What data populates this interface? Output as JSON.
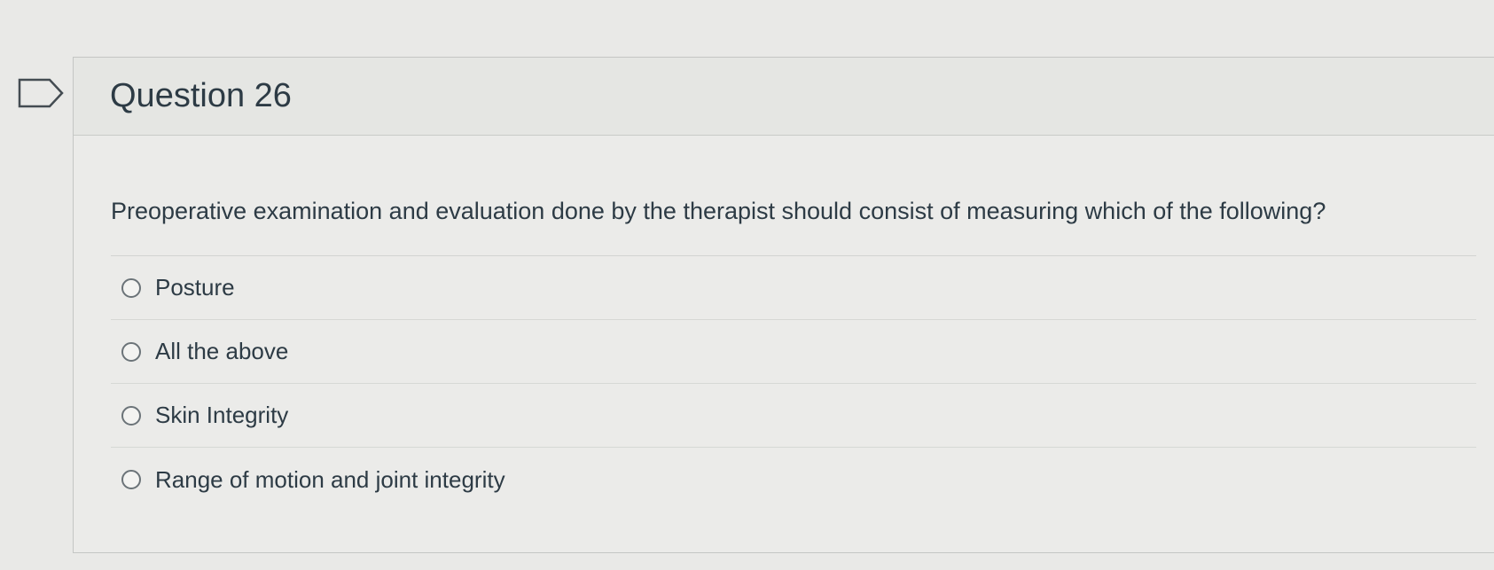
{
  "question": {
    "title": "Question 26",
    "text": "Preoperative examination and evaluation done by the therapist should consist of measuring which of the following?",
    "flag_icon": "flag-outline-icon",
    "answers": [
      {
        "label": "Posture",
        "selected": false
      },
      {
        "label": "All the above",
        "selected": false
      },
      {
        "label": "Skin Integrity",
        "selected": false
      },
      {
        "label": "Range of motion and joint integrity",
        "selected": false
      }
    ]
  },
  "colors": {
    "background": "#e9e9e7",
    "text": "#2d3b45",
    "border": "#c4c6c4"
  }
}
